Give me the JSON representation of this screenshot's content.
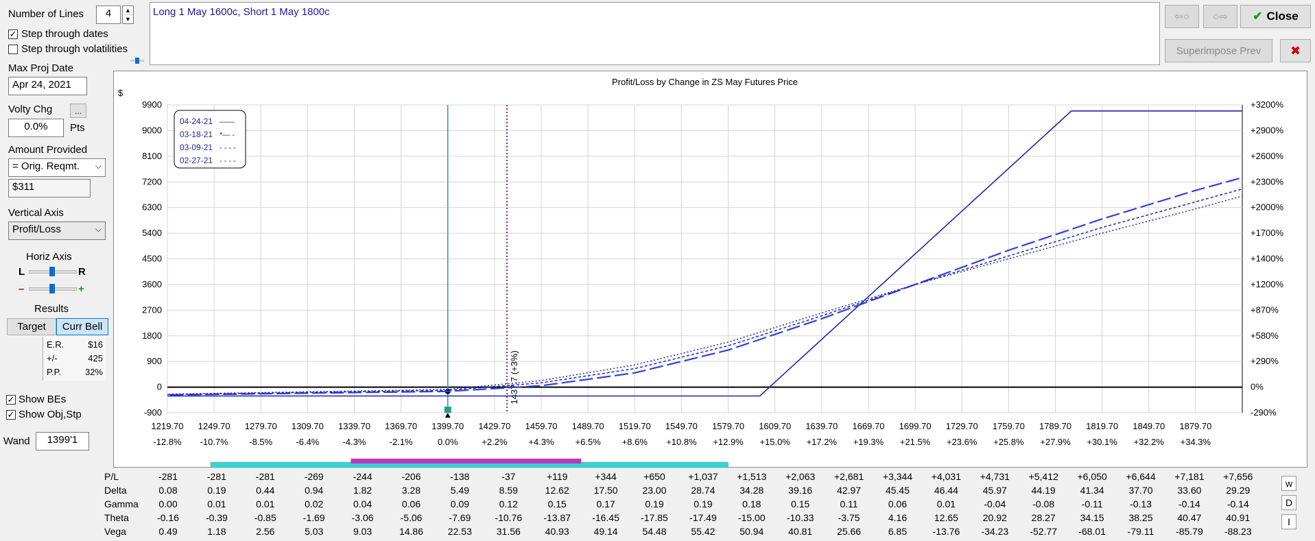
{
  "controls": {
    "number_of_lines_label": "Number of Lines",
    "number_of_lines_value": "4",
    "step_dates_label": "Step through dates",
    "step_dates_checked": "✓",
    "step_vols_label": "Step through volatilities",
    "step_vols_checked": "",
    "max_proj_date_label": "Max Proj Date",
    "max_proj_date_value": "Apr 24, 2021",
    "volty_chg_label": "Volty Chg",
    "volty_more_button": "...",
    "volty_chg_value": "0.0%",
    "volty_unit": "Pts",
    "amount_provided_label": "Amount Provided",
    "amount_provided_select": "= Orig. Reqmt.",
    "amount_value": "$311",
    "vertical_axis_label": "Vertical Axis",
    "vertical_axis_select": "Profit/Loss",
    "horiz_axis_label": "Horiz Axis",
    "horiz_l": "L",
    "horiz_r": "R",
    "zoom_minus": "–",
    "zoom_plus": "+",
    "results_label": "Results",
    "target_button": "Target",
    "curr_bell_button": "Curr Bell",
    "er_label": "E.R.",
    "er_value": "$16",
    "pm_label": "+/-",
    "pm_value": "425",
    "pp_label": "P.P.",
    "pp_value": "32%",
    "show_bes_label": "Show BEs",
    "show_bes_checked": "✓",
    "show_obj_label": "Show Obj,Stp",
    "show_obj_checked": "✓",
    "wand_label": "Wand",
    "wand_value": "1399'1"
  },
  "description": "Long 1 May 1600c, Short 1 May 1800c",
  "top_buttons": {
    "prev_arrow": "⇦○",
    "next_arrow": "○⇨",
    "close_label": "Close",
    "check_icon": "✔",
    "superimpose_label": "Superimpose Prev",
    "x_icon": "✖"
  },
  "colors": {
    "line_blue": "#1f24a8",
    "dash_blue": "#2f3fe0",
    "teal": "#2a9d8f",
    "purple": "#8b1a9b",
    "cyan_bar": "#33d6d6",
    "magenta_bar": "#c033c0"
  },
  "chart_data": {
    "type": "line",
    "title": "Profit/Loss by Change in ZS May Futures Price",
    "y_unit": "$",
    "y_ticks": [
      9900,
      9000,
      8100,
      7200,
      6300,
      5400,
      4500,
      3600,
      2700,
      1800,
      900,
      0,
      -900
    ],
    "ylim": [
      -900,
      9900
    ],
    "right_ticks": [
      "+3200%",
      "+2900%",
      "+2600%",
      "+2300%",
      "+2000%",
      "+1700%",
      "+1400%",
      "+1200%",
      "+870%",
      "+580%",
      "+290%",
      "0%",
      "-290%"
    ],
    "x_ticks": [
      "1219.70",
      "1249.70",
      "1279.70",
      "1309.70",
      "1339.70",
      "1369.70",
      "1399.70",
      "1429.70",
      "1459.70",
      "1489.70",
      "1519.70",
      "1549.70",
      "1579.70",
      "1609.70",
      "1639.70",
      "1669.70",
      "1699.70",
      "1729.70",
      "1759.70",
      "1789.70",
      "1819.70",
      "1849.70",
      "1879.70"
    ],
    "x_pct_ticks": [
      "-12.8%",
      "-10.7%",
      "-8.5%",
      "-6.4%",
      "-4.3%",
      "-2.1%",
      "0.0%",
      "+2.2%",
      "+4.3%",
      "+6.5%",
      "+8.6%",
      "+10.8%",
      "+12.9%",
      "+15.0%",
      "+17.2%",
      "+19.3%",
      "+21.5%",
      "+23.6%",
      "+25.8%",
      "+27.9%",
      "+30.1%",
      "+32.2%",
      "+34.3%"
    ],
    "xlim": [
      1219.7,
      1909.7
    ],
    "current_price": 1399.7,
    "breakeven_price": 1437.7,
    "breakeven_label": "1437.7 (+3%)",
    "legend": [
      {
        "name": "04-24-21",
        "style": "solid",
        "sample": "——"
      },
      {
        "name": "03-18-21",
        "style": "longdash",
        "sample": "*— -"
      },
      {
        "name": "03-09-21",
        "style": "dashed",
        "sample": "- - - -"
      },
      {
        "name": "02-27-21",
        "style": "dotted",
        "sample": "- - - -"
      }
    ],
    "series": [
      {
        "name": "04-24-21",
        "style": "solid",
        "x": [
          1209.7,
          1600,
          1800,
          1909.7
        ],
        "y": [
          -311,
          -311,
          9689,
          9689
        ]
      },
      {
        "name": "03-18-21",
        "style": "longdash",
        "x": [
          1209.7,
          1399.7,
          1459.7,
          1519.7,
          1579.7,
          1639.7,
          1699.7,
          1759.7,
          1819.7,
          1879.7,
          1909.7
        ],
        "y": [
          -281,
          -150,
          50,
          500,
          1300,
          2400,
          3600,
          4800,
          5900,
          6900,
          7350
        ]
      },
      {
        "name": "03-09-21",
        "style": "dashed",
        "x": [
          1209.7,
          1399.7,
          1459.7,
          1519.7,
          1579.7,
          1639.7,
          1699.7,
          1759.7,
          1819.7,
          1879.7,
          1909.7
        ],
        "y": [
          -270,
          -110,
          150,
          650,
          1450,
          2500,
          3600,
          4600,
          5600,
          6500,
          6950
        ]
      },
      {
        "name": "02-27-21",
        "style": "dotted",
        "x": [
          1209.7,
          1399.7,
          1459.7,
          1519.7,
          1579.7,
          1639.7,
          1699.7,
          1759.7,
          1819.7,
          1879.7,
          1909.7
        ],
        "y": [
          -255,
          -80,
          230,
          780,
          1580,
          2600,
          3600,
          4500,
          5400,
          6250,
          6700
        ]
      }
    ]
  },
  "greeks": {
    "rows": [
      {
        "label": "P/L",
        "values": [
          "-281",
          "-281",
          "-281",
          "-269",
          "-244",
          "-206",
          "-138",
          "-37",
          "+119",
          "+344",
          "+650",
          "+1,037",
          "+1,513",
          "+2,063",
          "+2,681",
          "+3,344",
          "+4,031",
          "+4,731",
          "+5,412",
          "+6,050",
          "+6,644",
          "+7,181",
          "+7,656"
        ]
      },
      {
        "label": "Delta",
        "values": [
          "0.08",
          "0.19",
          "0.44",
          "0.94",
          "1.82",
          "3.28",
          "5.49",
          "8.59",
          "12.62",
          "17.50",
          "23.00",
          "28.74",
          "34.28",
          "39.16",
          "42.97",
          "45.45",
          "46.44",
          "45.97",
          "44.19",
          "41.34",
          "37.70",
          "33.60",
          "29.29"
        ]
      },
      {
        "label": "Gamma",
        "values": [
          "0.00",
          "0.01",
          "0.01",
          "0.02",
          "0.04",
          "0.06",
          "0.09",
          "0.12",
          "0.15",
          "0.17",
          "0.19",
          "0.19",
          "0.18",
          "0.15",
          "0.11",
          "0.06",
          "0.01",
          "-0.04",
          "-0.08",
          "-0.11",
          "-0.13",
          "-0.14",
          "-0.14"
        ]
      },
      {
        "label": "Theta",
        "values": [
          "-0.16",
          "-0.39",
          "-0.85",
          "-1.69",
          "-3.06",
          "-5.06",
          "-7.69",
          "-10.76",
          "-13.87",
          "-16.45",
          "-17.85",
          "-17.49",
          "-15.00",
          "-10.33",
          "-3.75",
          "4.16",
          "12.65",
          "20.92",
          "28.27",
          "34.15",
          "38.25",
          "40.47",
          "40.91"
        ]
      },
      {
        "label": "Vega",
        "values": [
          "0.49",
          "1.18",
          "2.56",
          "5.03",
          "9.03",
          "14.86",
          "22.53",
          "31.56",
          "40.93",
          "49.14",
          "54.48",
          "55.42",
          "50.94",
          "40.81",
          "25.66",
          "6.85",
          "-13.76",
          "-34.23",
          "-52.77",
          "-68.01",
          "-79.11",
          "-85.79",
          "-88.23"
        ]
      }
    ],
    "side_buttons": [
      "w",
      "D",
      "I"
    ]
  }
}
